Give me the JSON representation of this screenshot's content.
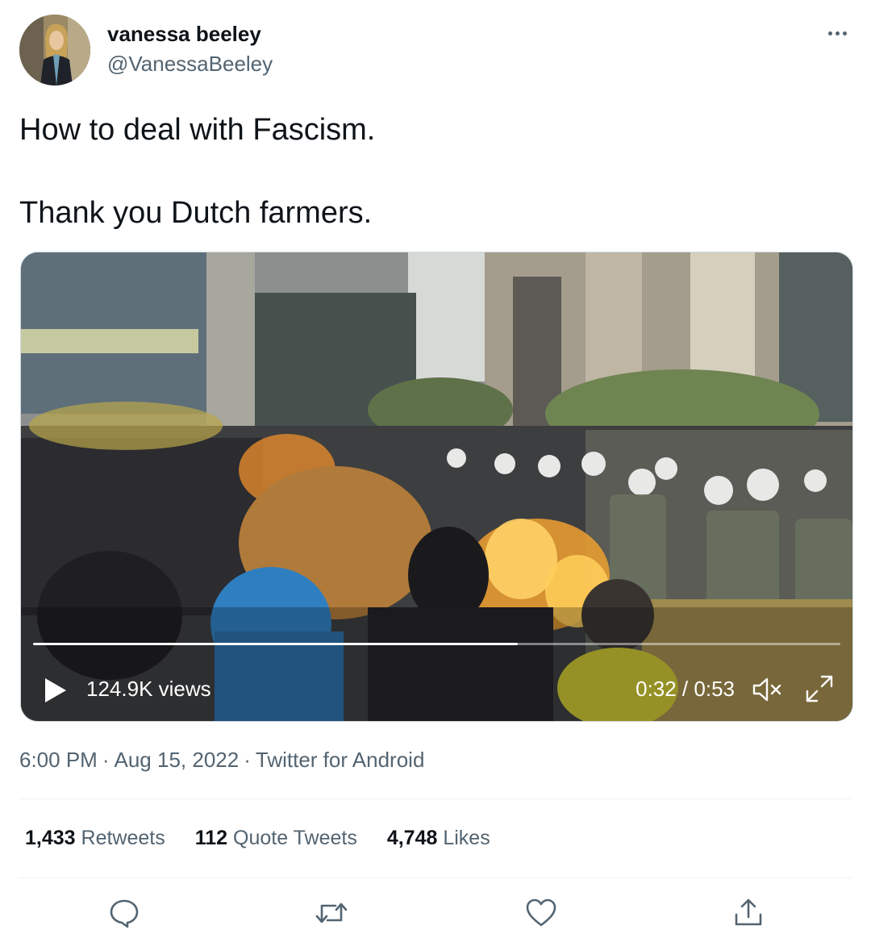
{
  "author": {
    "name": "vanessa beeley",
    "handle": "@VanessaBeeley",
    "avatar_icon": "avatar"
  },
  "tweet": {
    "line1": "How to deal with Fascism.",
    "line2": "Thank you Dutch farmers."
  },
  "video": {
    "views": "124.9K views",
    "time": "0:32 / 0:53",
    "progress": 0.6
  },
  "meta": {
    "time": "6:00 PM",
    "date": "Aug 15, 2022",
    "source": "Twitter for Android"
  },
  "stats": [
    {
      "count": "1,433",
      "label": "Retweets"
    },
    {
      "count": "112",
      "label": "Quote Tweets"
    },
    {
      "count": "4,748",
      "label": "Likes"
    }
  ],
  "colors": {
    "text": "#0f1419",
    "secondary": "#536471",
    "divider": "#eff3f4"
  }
}
